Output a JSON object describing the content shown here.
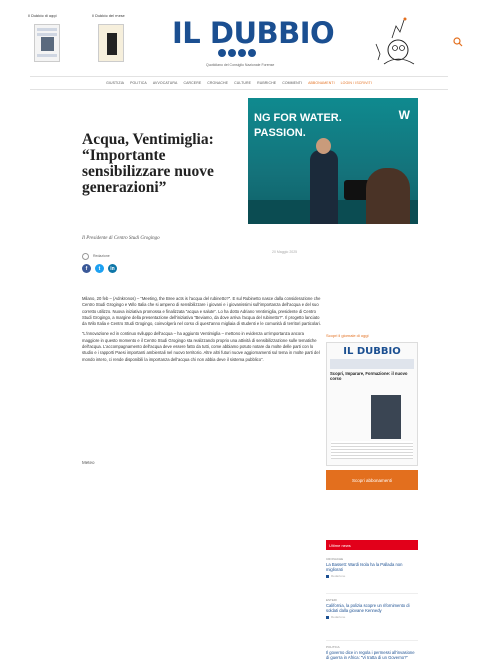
{
  "header": {
    "thumb1_label": "Il Dubbio di oggi",
    "thumb2_label": "Il Dubbio del mese",
    "logo_text": "IL DUBBIO",
    "tagline": "Quotidiano del Consiglio Nazionale Forense"
  },
  "nav": [
    {
      "label": "GIUSTIZIA",
      "highlight": false
    },
    {
      "label": "POLITICA",
      "highlight": false
    },
    {
      "label": "AVVOCATURA",
      "highlight": false
    },
    {
      "label": "CARCERE",
      "highlight": false
    },
    {
      "label": "CRONACHE",
      "highlight": false
    },
    {
      "label": "CULTURE",
      "highlight": false
    },
    {
      "label": "RUBRICHE",
      "highlight": false
    },
    {
      "label": "COMMENTI",
      "highlight": false
    },
    {
      "label": "ABBONAMENTI",
      "highlight": true
    },
    {
      "label": "LOGIN / ISCRIVITI",
      "highlight": true
    }
  ],
  "article": {
    "headline": "Acqua, Ventimiglia: “Importante sensibilizzare nuove generazioni”",
    "image_text_1": "NG FOR WATER.",
    "image_text_2": "PASSION.",
    "image_text_3": "W",
    "subtitle": "Il Presidente di Centro Studi Grogingo",
    "author": "Redazione",
    "date": "20 Maggio 2025",
    "paragraphs": [
      "Milano, 20 feb – (Adnkronos) – “Meeting, the Bree acts is l'acqua del rubinetto?”. E sul Rubinetto nasce dalla considerazione che Centro Studi Grogingo e Wilo Italia che si ampeno di sensibilizzare i giovani e i giovanissimi sull'importanza dell'acqua e del suo corretto utilizzo. Nuova iniziativa promossa e finalizzata “acqua e salute”. Lo ha dotto Adriano Ventimiglia, presidente di Centro Studi Grogingo, a margine della presentazione dell'iniziativa “Beviamo, da dove arriva l'acqua del rubinetto?”. Il progetto lanciato da Wilo Italia e Centro Studi Grogingo, coinvolgerà nel corso di quest'anno migliaia di studenti e le comunità di territori particolari.",
      "“L'innovazione ed in continuo sviluppo dell'acqua – ha aggiunto Ventimiglia – mettono in evidenza un'importanza ancora maggiore in questo momento e il Centro Studi Grogingo sta realizzando proprio una attività di sensibilizzazione sulle tematiche dell'acqua. L'accompagnamento dell'acqua deve essere fatto da tutti, come abbiamo potuto notare da molte delle parti con lo studio e i rapporti Paesi importanti ambientali nel nuovo territorio. Altre altri futuri nuove aggiornamenti sul tema in molte parti del mondo intero, ci rende disponibili la importanza dell'acqua chi non abbia deve il sistema pubblico”."
    ],
    "more_label": "Meteo"
  },
  "sidebar": {
    "title": "Scopri il giornale di oggi",
    "paper_title": "IL DUBBIO",
    "paper_headline": "Scopri, Imparare, Formazione: il nuovo corso",
    "button_label": "Scopri abbonamenti",
    "news_label": "Ultime news",
    "news": [
      {
        "category": "CRONACHE",
        "title": "La Bassett: Wardi Isola ha la Pallada non migliorati",
        "meta": "Redazione"
      },
      {
        "category": "ESTERI",
        "title": "California, la polizia scopre un rifornimento di soldati dalla giovane Kennedy",
        "meta": "Redazione"
      },
      {
        "category": "POLITICA",
        "title": "Il governo dice in regola i permessi all'invasione di guerra in Africa: “Vi tratta di un Governo?”",
        "meta": "Redazione"
      }
    ]
  },
  "colors": {
    "brand_blue": "#1b4f91",
    "accent_orange": "#e36f1e",
    "news_red": "#e2001a",
    "share_facebook": "#3b5998",
    "share_twitter": "#1da1f2",
    "share_linkedin": "#0e76a8"
  }
}
